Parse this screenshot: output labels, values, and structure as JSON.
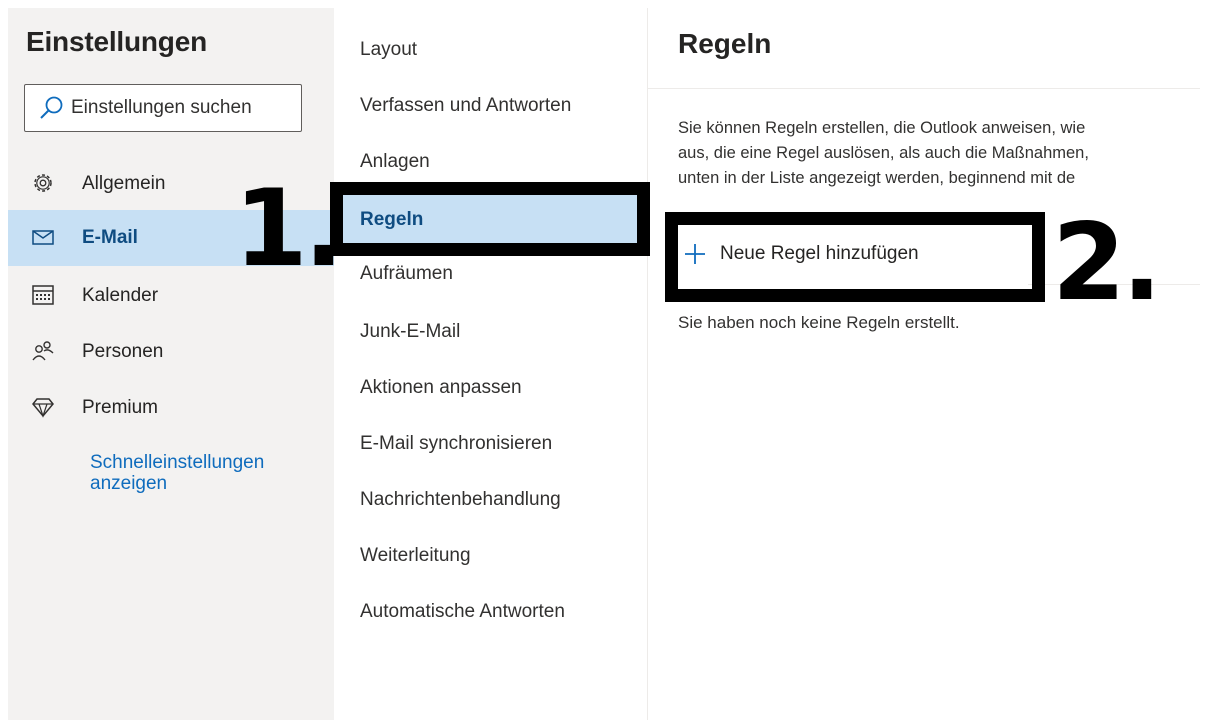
{
  "settings": {
    "title": "Einstellungen",
    "search_placeholder": "Einstellungen suchen",
    "nav": [
      {
        "label": "Allgemein",
        "icon": "gear-icon"
      },
      {
        "label": "E-Mail",
        "icon": "mail-icon",
        "selected": true
      },
      {
        "label": "Kalender",
        "icon": "calendar-icon"
      },
      {
        "label": "Personen",
        "icon": "people-icon"
      },
      {
        "label": "Premium",
        "icon": "diamond-icon"
      }
    ],
    "quick_settings_link": "Schnelleinstellungen anzeigen"
  },
  "mail_categories": [
    "Layout",
    "Verfassen und Antworten",
    "Anlagen",
    "Regeln",
    "Aufräumen",
    "Junk-E-Mail",
    "Aktionen anpassen",
    "E-Mail synchronisieren",
    "Nachrichtenbehandlung",
    "Weiterleitung",
    "Automatische Antworten"
  ],
  "selected_category": "Regeln",
  "rules": {
    "title": "Regeln",
    "description_lines": [
      "Sie können Regeln erstellen, die Outlook anweisen, wie",
      "aus, die eine Regel auslösen, als auch die Maßnahmen,",
      "unten in der Liste angezeigt werden, beginnend mit de"
    ],
    "add_rule_label": "Neue Regel hinzufügen",
    "empty_message": "Sie haben noch keine Regeln erstellt."
  },
  "annotations": {
    "step1": "1.",
    "step2": "2."
  },
  "colors": {
    "selected_background": "#c7e0f4",
    "accent_blue": "#0f6cbd",
    "left_pane_background": "#f3f2f1",
    "annotation": "#000000"
  }
}
